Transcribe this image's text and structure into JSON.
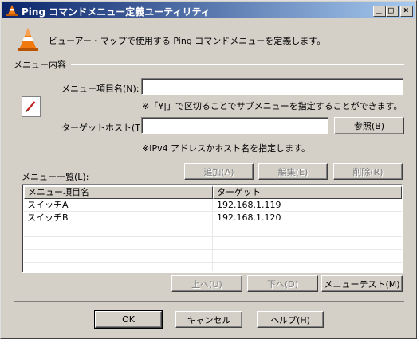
{
  "window": {
    "title": "Ping コマンドメニュー定義ユーティリティ",
    "minimize_glyph": "_",
    "maximize_glyph": "□",
    "close_glyph": "×"
  },
  "header": {
    "description": "ビューアー・マップで使用する Ping コマンドメニューを定義します。"
  },
  "group": {
    "title": "メニュー内容"
  },
  "form": {
    "menu_item_label": "メニュー項目名(N):",
    "menu_item_value": "",
    "menu_item_hint": "※「¥|」で区切ることでサブメニューを指定することができます。",
    "target_host_label": "ターゲットホスト(T):",
    "target_host_value": "",
    "browse_button": "参照(B)",
    "target_host_hint": "※IPv4 アドレスかホスト名を指定します。"
  },
  "list": {
    "label": "メニュー一覧(L):",
    "add_button": "追加(A)",
    "edit_button": "編集(E)",
    "delete_button": "削除(R)",
    "columns": [
      "メニュー項目名",
      "ターゲット"
    ],
    "rows": [
      {
        "name": "スイッチA",
        "target": "192.168.1.119"
      },
      {
        "name": "スイッチB",
        "target": "192.168.1.120"
      }
    ],
    "up_button": "上へ(U)",
    "down_button": "下へ(D)",
    "test_button": "メニューテスト(M)"
  },
  "footer": {
    "ok_button": "OK",
    "cancel_button": "キャンセル",
    "help_button": "ヘルプ(H)"
  },
  "icons": {
    "app": "traffic-cone-icon",
    "header": "traffic-cone-icon",
    "edit": "pencil-icon"
  },
  "colors": {
    "titlebar_start": "#0a246a",
    "titlebar_end": "#a6caf0",
    "dialog_bg": "#d4d0c8",
    "cone_orange": "#f07a10"
  }
}
